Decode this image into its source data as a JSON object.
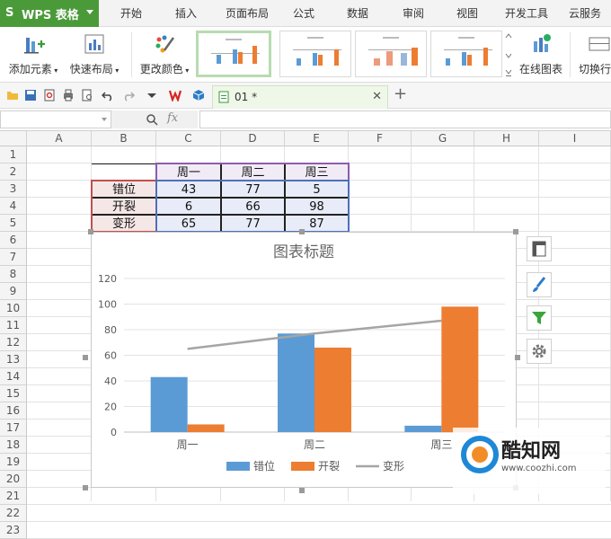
{
  "app": {
    "name": "WPS 表格",
    "accent": "#4a9a3a"
  },
  "menu": {
    "tabs": [
      "开始",
      "插入",
      "页面布局",
      "公式",
      "数据",
      "审阅",
      "视图",
      "开发工具",
      "云服务"
    ]
  },
  "ribbon": {
    "add_element": "添加元素",
    "quick_layout": "快速布局",
    "change_color": "更改颜色",
    "online_chart": "在线图表",
    "switch_rowcol": "切换行"
  },
  "quickbar": {
    "doc_tab": "01 *"
  },
  "formula": {
    "name_box": "",
    "fx": "fx"
  },
  "grid": {
    "columns": [
      "A",
      "B",
      "C",
      "D",
      "E",
      "F",
      "G",
      "H",
      "I"
    ],
    "rows": [
      "1",
      "2",
      "3",
      "4",
      "5",
      "6",
      "7",
      "8",
      "9",
      "10",
      "11",
      "12",
      "13",
      "14",
      "15",
      "16",
      "17",
      "18",
      "19",
      "20",
      "21",
      "22",
      "23"
    ]
  },
  "table": {
    "headers": [
      "周一",
      "周二",
      "周三"
    ],
    "rows": [
      {
        "label": "错位",
        "values": [
          "43",
          "77",
          "5"
        ]
      },
      {
        "label": "开裂",
        "values": [
          "6",
          "66",
          "98"
        ]
      },
      {
        "label": "变形",
        "values": [
          "65",
          "77",
          "87"
        ]
      }
    ]
  },
  "chart_data": {
    "type": "bar",
    "title": "图表标题",
    "categories": [
      "周一",
      "周二",
      "周三"
    ],
    "series": [
      {
        "name": "错位",
        "type": "bar",
        "values": [
          43,
          77,
          5
        ],
        "color": "#5b9bd5"
      },
      {
        "name": "开裂",
        "type": "bar",
        "values": [
          6,
          66,
          98
        ],
        "color": "#ed7d31"
      },
      {
        "name": "变形",
        "type": "line",
        "values": [
          65,
          77,
          87
        ],
        "color": "#a5a5a5"
      }
    ],
    "yticks": [
      "0",
      "20",
      "40",
      "60",
      "80",
      "100",
      "120"
    ],
    "ylim": [
      0,
      120
    ],
    "grid": true,
    "legend_position": "bottom"
  },
  "watermark": {
    "brand": "酷知网",
    "url": "www.coozhi.com"
  }
}
